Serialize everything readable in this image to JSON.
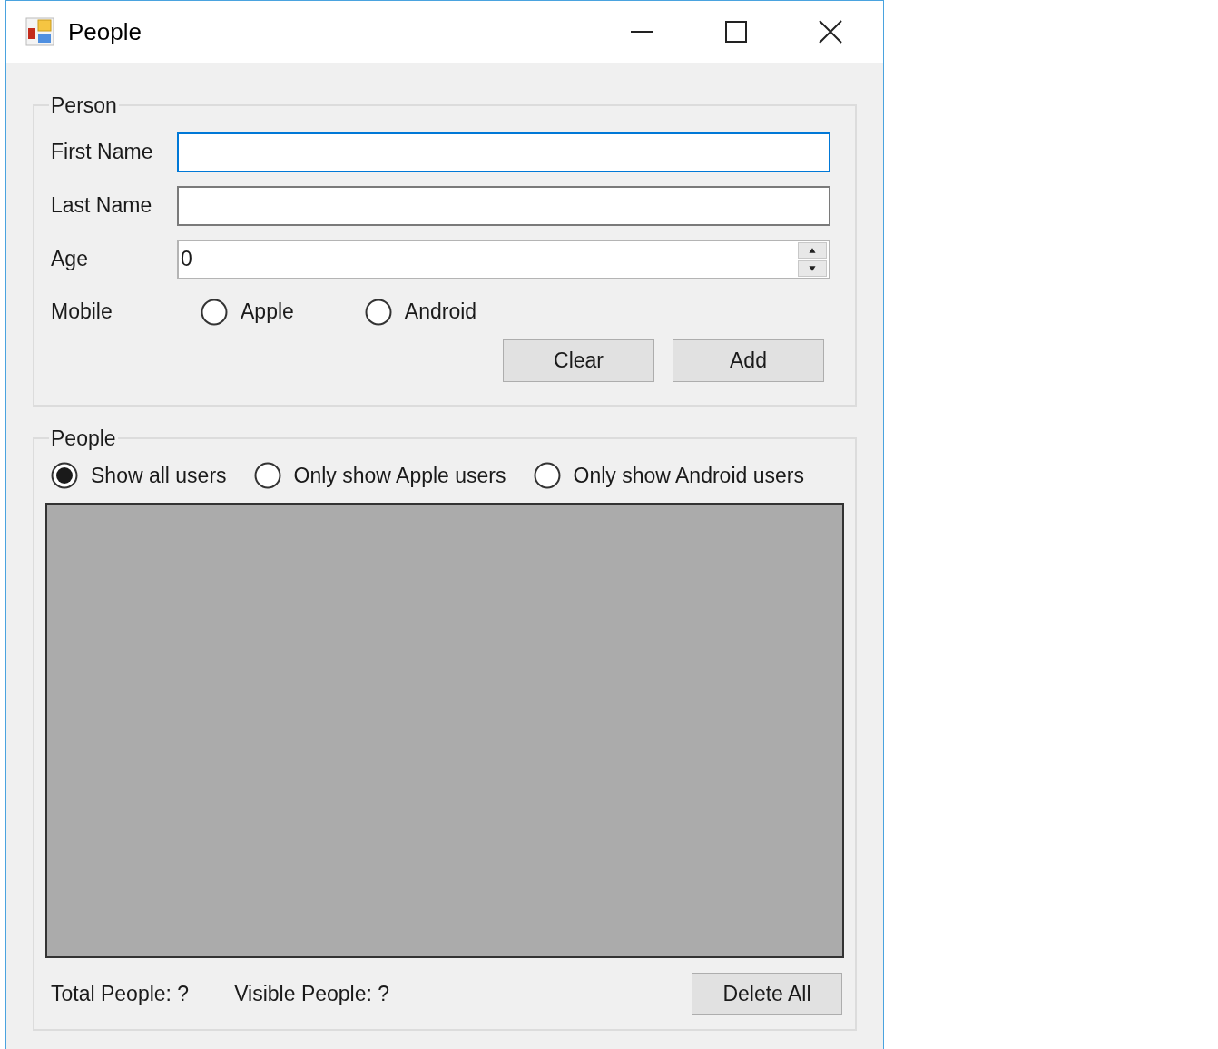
{
  "window": {
    "title": "People"
  },
  "person_group": {
    "title": "Person",
    "fields": [
      {
        "kind": "text",
        "label": "First Name",
        "focused": true
      },
      {
        "kind": "text",
        "label": "Last Name",
        "focused": false
      },
      {
        "kind": "spin",
        "label": "Age",
        "value": "0",
        "focused": false
      }
    ],
    "mobile": {
      "label": "Mobile",
      "options": [
        {
          "label": "Apple",
          "selected": false
        },
        {
          "label": "Android",
          "selected": false
        }
      ]
    },
    "buttons": [
      "Clear",
      "Add"
    ]
  },
  "people_group": {
    "title": "People",
    "filters": [
      {
        "label": "Show all users",
        "selected": true
      },
      {
        "label": "Only show Apple users",
        "selected": false
      },
      {
        "label": "Only show Android users",
        "selected": false
      }
    ],
    "total": "Total People: ?",
    "visible": "Visible People: ?",
    "delete_button": "Delete All"
  }
}
